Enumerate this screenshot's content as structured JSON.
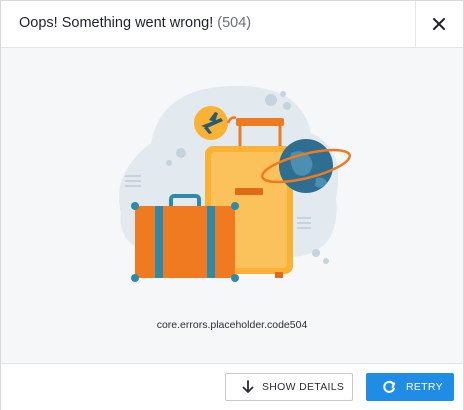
{
  "dialog": {
    "title": "Oops! Something went wrong!",
    "status_code": "(504)"
  },
  "body": {
    "error_key": "core.errors.placeholder.code504",
    "illustration": "travel-luggage-illustration"
  },
  "footer": {
    "show_details_label": "SHOW DETAILS",
    "retry_label": "RETRY"
  },
  "icons": {
    "close": "close-icon",
    "show_details": "arrow-down-icon",
    "retry": "refresh-icon",
    "plane": "airplane-icon",
    "globe": "globe-icon"
  },
  "colors": {
    "primary": "#1f8ce6",
    "suitcase_orange": "#f07a1f",
    "suitcase_yellow": "#f9b233",
    "accent_teal": "#2f8aa8"
  }
}
